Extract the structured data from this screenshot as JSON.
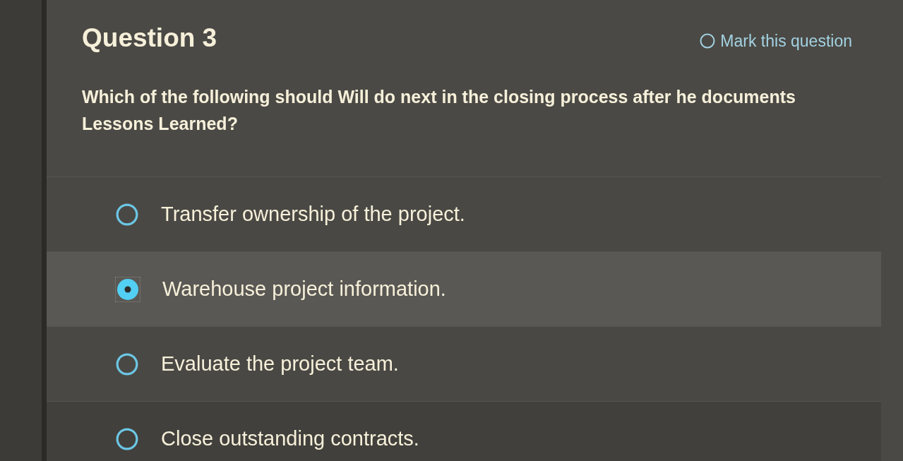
{
  "question": {
    "title": "Question 3",
    "mark": {
      "label": "Mark this question",
      "checked": false
    },
    "text": "Which of the following should Will do next in the closing process after he documents Lessons Learned?"
  },
  "options": [
    {
      "label": "Transfer ownership of the project.",
      "selected": false
    },
    {
      "label": "Warehouse project information.",
      "selected": true
    },
    {
      "label": "Evaluate the project team.",
      "selected": false
    },
    {
      "label": "Close outstanding contracts.",
      "selected": false
    }
  ]
}
